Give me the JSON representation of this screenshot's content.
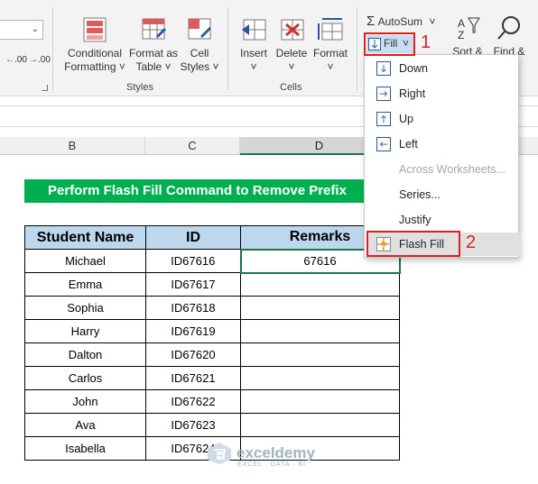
{
  "ribbon": {
    "styles_group_label": "Styles",
    "cells_group_label": "Cells",
    "buttons": {
      "conditional_formatting": [
        "Conditional",
        "Formatting ˅"
      ],
      "format_as_table": [
        "Format as",
        "Table ˅"
      ],
      "cell_styles": [
        "Cell",
        "Styles ˅"
      ],
      "insert": [
        "Insert",
        "˅"
      ],
      "delete": [
        "Delete",
        "˅"
      ],
      "format": [
        "Format",
        "˅"
      ],
      "autosum": "AutoSum",
      "fill": "Fill",
      "sort_filter": "Sort &",
      "find_select": "Find &"
    },
    "number_format": {
      "inc_decimal": ".00",
      "dec_decimal": ".00"
    },
    "autosum_arrow": "˅",
    "fill_arrow": "˅"
  },
  "columns": [
    "B",
    "C",
    "D"
  ],
  "selected_column": "D",
  "banner_text": "Perform Flash Fill Command to Remove Prefix",
  "table": {
    "headers": [
      "Student Name",
      "ID",
      "Remarks"
    ],
    "rows": [
      [
        "Michael",
        "ID67616",
        "67616"
      ],
      [
        "Emma",
        "ID67617",
        ""
      ],
      [
        "Sophia",
        "ID67618",
        ""
      ],
      [
        "Harry",
        "ID67619",
        ""
      ],
      [
        "Dalton",
        "ID67620",
        ""
      ],
      [
        "Carlos",
        "ID67621",
        ""
      ],
      [
        "John",
        "ID67622",
        ""
      ],
      [
        "Ava",
        "ID67623",
        ""
      ],
      [
        "Isabella",
        "ID67624",
        ""
      ]
    ]
  },
  "fill_menu": {
    "items": [
      {
        "label": "Down",
        "enabled": true
      },
      {
        "label": "Right",
        "enabled": true
      },
      {
        "label": "Up",
        "enabled": true
      },
      {
        "label": "Left",
        "enabled": true
      },
      {
        "label": "Across Worksheets...",
        "enabled": false
      },
      {
        "label": "Series...",
        "enabled": true
      },
      {
        "label": "Justify",
        "enabled": true
      },
      {
        "label": "Flash Fill",
        "enabled": true,
        "highlighted": true
      }
    ]
  },
  "annotations": {
    "step1": "1",
    "step2": "2",
    "highlight_color": "#e02020"
  },
  "watermark": {
    "name": "exceldemy",
    "tagline": "EXCEL · DATA · BI"
  },
  "colors": {
    "banner_bg": "#00b050",
    "header_bg": "#bdd7ee",
    "excel_green": "#217346"
  }
}
